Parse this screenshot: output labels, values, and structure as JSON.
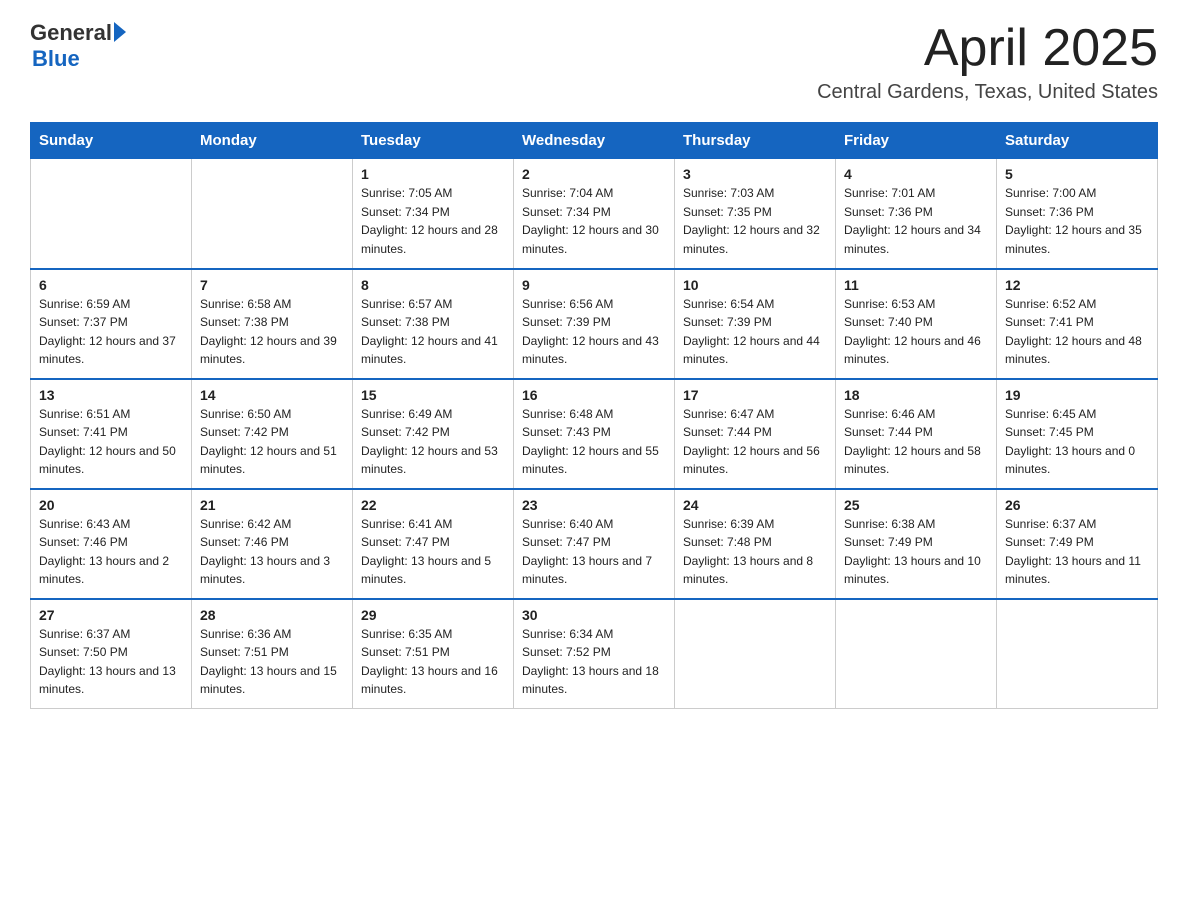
{
  "header": {
    "logo_general": "General",
    "logo_blue": "Blue",
    "title": "April 2025",
    "subtitle": "Central Gardens, Texas, United States"
  },
  "days_of_week": [
    "Sunday",
    "Monday",
    "Tuesday",
    "Wednesday",
    "Thursday",
    "Friday",
    "Saturday"
  ],
  "weeks": [
    [
      {
        "day": "",
        "sunrise": "",
        "sunset": "",
        "daylight": ""
      },
      {
        "day": "",
        "sunrise": "",
        "sunset": "",
        "daylight": ""
      },
      {
        "day": "1",
        "sunrise": "Sunrise: 7:05 AM",
        "sunset": "Sunset: 7:34 PM",
        "daylight": "Daylight: 12 hours and 28 minutes."
      },
      {
        "day": "2",
        "sunrise": "Sunrise: 7:04 AM",
        "sunset": "Sunset: 7:34 PM",
        "daylight": "Daylight: 12 hours and 30 minutes."
      },
      {
        "day": "3",
        "sunrise": "Sunrise: 7:03 AM",
        "sunset": "Sunset: 7:35 PM",
        "daylight": "Daylight: 12 hours and 32 minutes."
      },
      {
        "day": "4",
        "sunrise": "Sunrise: 7:01 AM",
        "sunset": "Sunset: 7:36 PM",
        "daylight": "Daylight: 12 hours and 34 minutes."
      },
      {
        "day": "5",
        "sunrise": "Sunrise: 7:00 AM",
        "sunset": "Sunset: 7:36 PM",
        "daylight": "Daylight: 12 hours and 35 minutes."
      }
    ],
    [
      {
        "day": "6",
        "sunrise": "Sunrise: 6:59 AM",
        "sunset": "Sunset: 7:37 PM",
        "daylight": "Daylight: 12 hours and 37 minutes."
      },
      {
        "day": "7",
        "sunrise": "Sunrise: 6:58 AM",
        "sunset": "Sunset: 7:38 PM",
        "daylight": "Daylight: 12 hours and 39 minutes."
      },
      {
        "day": "8",
        "sunrise": "Sunrise: 6:57 AM",
        "sunset": "Sunset: 7:38 PM",
        "daylight": "Daylight: 12 hours and 41 minutes."
      },
      {
        "day": "9",
        "sunrise": "Sunrise: 6:56 AM",
        "sunset": "Sunset: 7:39 PM",
        "daylight": "Daylight: 12 hours and 43 minutes."
      },
      {
        "day": "10",
        "sunrise": "Sunrise: 6:54 AM",
        "sunset": "Sunset: 7:39 PM",
        "daylight": "Daylight: 12 hours and 44 minutes."
      },
      {
        "day": "11",
        "sunrise": "Sunrise: 6:53 AM",
        "sunset": "Sunset: 7:40 PM",
        "daylight": "Daylight: 12 hours and 46 minutes."
      },
      {
        "day": "12",
        "sunrise": "Sunrise: 6:52 AM",
        "sunset": "Sunset: 7:41 PM",
        "daylight": "Daylight: 12 hours and 48 minutes."
      }
    ],
    [
      {
        "day": "13",
        "sunrise": "Sunrise: 6:51 AM",
        "sunset": "Sunset: 7:41 PM",
        "daylight": "Daylight: 12 hours and 50 minutes."
      },
      {
        "day": "14",
        "sunrise": "Sunrise: 6:50 AM",
        "sunset": "Sunset: 7:42 PM",
        "daylight": "Daylight: 12 hours and 51 minutes."
      },
      {
        "day": "15",
        "sunrise": "Sunrise: 6:49 AM",
        "sunset": "Sunset: 7:42 PM",
        "daylight": "Daylight: 12 hours and 53 minutes."
      },
      {
        "day": "16",
        "sunrise": "Sunrise: 6:48 AM",
        "sunset": "Sunset: 7:43 PM",
        "daylight": "Daylight: 12 hours and 55 minutes."
      },
      {
        "day": "17",
        "sunrise": "Sunrise: 6:47 AM",
        "sunset": "Sunset: 7:44 PM",
        "daylight": "Daylight: 12 hours and 56 minutes."
      },
      {
        "day": "18",
        "sunrise": "Sunrise: 6:46 AM",
        "sunset": "Sunset: 7:44 PM",
        "daylight": "Daylight: 12 hours and 58 minutes."
      },
      {
        "day": "19",
        "sunrise": "Sunrise: 6:45 AM",
        "sunset": "Sunset: 7:45 PM",
        "daylight": "Daylight: 13 hours and 0 minutes."
      }
    ],
    [
      {
        "day": "20",
        "sunrise": "Sunrise: 6:43 AM",
        "sunset": "Sunset: 7:46 PM",
        "daylight": "Daylight: 13 hours and 2 minutes."
      },
      {
        "day": "21",
        "sunrise": "Sunrise: 6:42 AM",
        "sunset": "Sunset: 7:46 PM",
        "daylight": "Daylight: 13 hours and 3 minutes."
      },
      {
        "day": "22",
        "sunrise": "Sunrise: 6:41 AM",
        "sunset": "Sunset: 7:47 PM",
        "daylight": "Daylight: 13 hours and 5 minutes."
      },
      {
        "day": "23",
        "sunrise": "Sunrise: 6:40 AM",
        "sunset": "Sunset: 7:47 PM",
        "daylight": "Daylight: 13 hours and 7 minutes."
      },
      {
        "day": "24",
        "sunrise": "Sunrise: 6:39 AM",
        "sunset": "Sunset: 7:48 PM",
        "daylight": "Daylight: 13 hours and 8 minutes."
      },
      {
        "day": "25",
        "sunrise": "Sunrise: 6:38 AM",
        "sunset": "Sunset: 7:49 PM",
        "daylight": "Daylight: 13 hours and 10 minutes."
      },
      {
        "day": "26",
        "sunrise": "Sunrise: 6:37 AM",
        "sunset": "Sunset: 7:49 PM",
        "daylight": "Daylight: 13 hours and 11 minutes."
      }
    ],
    [
      {
        "day": "27",
        "sunrise": "Sunrise: 6:37 AM",
        "sunset": "Sunset: 7:50 PM",
        "daylight": "Daylight: 13 hours and 13 minutes."
      },
      {
        "day": "28",
        "sunrise": "Sunrise: 6:36 AM",
        "sunset": "Sunset: 7:51 PM",
        "daylight": "Daylight: 13 hours and 15 minutes."
      },
      {
        "day": "29",
        "sunrise": "Sunrise: 6:35 AM",
        "sunset": "Sunset: 7:51 PM",
        "daylight": "Daylight: 13 hours and 16 minutes."
      },
      {
        "day": "30",
        "sunrise": "Sunrise: 6:34 AM",
        "sunset": "Sunset: 7:52 PM",
        "daylight": "Daylight: 13 hours and 18 minutes."
      },
      {
        "day": "",
        "sunrise": "",
        "sunset": "",
        "daylight": ""
      },
      {
        "day": "",
        "sunrise": "",
        "sunset": "",
        "daylight": ""
      },
      {
        "day": "",
        "sunrise": "",
        "sunset": "",
        "daylight": ""
      }
    ]
  ]
}
